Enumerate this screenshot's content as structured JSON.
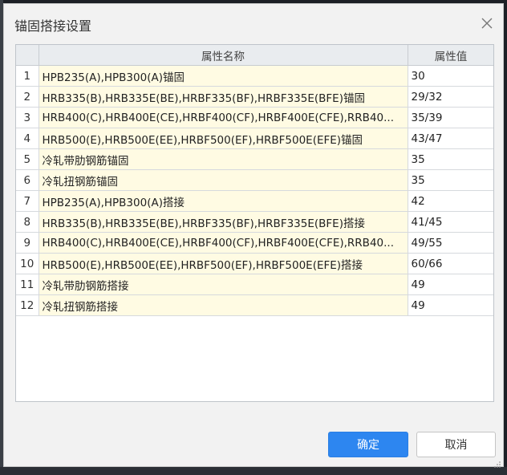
{
  "dialog": {
    "title": "锚固搭接设置",
    "close_icon": "close-icon"
  },
  "table": {
    "headers": [
      "",
      "属性名称",
      "属性值"
    ],
    "rows": [
      {
        "index": "1",
        "name": "HPB235(A),HPB300(A)锚固",
        "value": "30"
      },
      {
        "index": "2",
        "name": "HRB335(B),HRB335E(BE),HRBF335(BF),HRBF335E(BFE)锚固",
        "value": "29/32"
      },
      {
        "index": "3",
        "name": "HRB400(C),HRB400E(CE),HRBF400(CF),HRBF400E(CFE),RRB40...",
        "value": "35/39"
      },
      {
        "index": "4",
        "name": "HRB500(E),HRB500E(EE),HRBF500(EF),HRBF500E(EFE)锚固",
        "value": "43/47"
      },
      {
        "index": "5",
        "name": "冷轧带肋钢筋锚固",
        "value": "35"
      },
      {
        "index": "6",
        "name": "冷轧扭钢筋锚固",
        "value": "35"
      },
      {
        "index": "7",
        "name": "HPB235(A),HPB300(A)搭接",
        "value": "42"
      },
      {
        "index": "8",
        "name": "HRB335(B),HRB335E(BE),HRBF335(BF),HRBF335E(BFE)搭接",
        "value": "41/45"
      },
      {
        "index": "9",
        "name": "HRB400(C),HRB400E(CE),HRBF400(CF),HRBF400E(CFE),RRB40...",
        "value": "49/55"
      },
      {
        "index": "10",
        "name": "HRB500(E),HRB500E(EE),HRBF500(EF),HRBF500E(EFE)搭接",
        "value": "60/66"
      },
      {
        "index": "11",
        "name": "冷轧带肋钢筋搭接",
        "value": "49"
      },
      {
        "index": "12",
        "name": "冷轧扭钢筋搭接",
        "value": "49"
      }
    ]
  },
  "buttons": {
    "ok_label": "确定",
    "cancel_label": "取消"
  },
  "colors": {
    "primary": "#2d86f0",
    "name_cell_bg": "#fffbe3",
    "header_bg": "#e9ecef"
  }
}
